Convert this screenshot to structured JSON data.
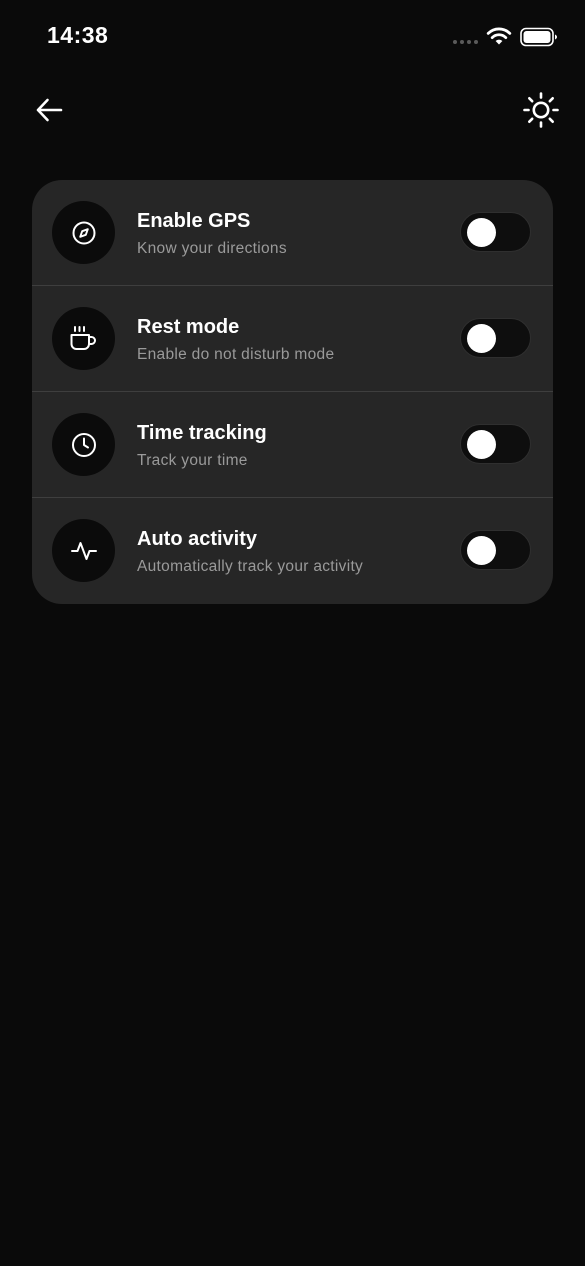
{
  "status_bar": {
    "time": "14:38"
  },
  "header": {
    "back_icon": "arrow-left-icon",
    "theme_icon": "sun-icon"
  },
  "settings": [
    {
      "icon": "compass-icon",
      "title": "Enable GPS",
      "subtitle": "Know your directions",
      "enabled": false
    },
    {
      "icon": "coffee-cup-icon",
      "title": "Rest mode",
      "subtitle": "Enable do not disturb mode",
      "enabled": false
    },
    {
      "icon": "clock-icon",
      "title": "Time tracking",
      "subtitle": "Track your time",
      "enabled": false
    },
    {
      "icon": "activity-pulse-icon",
      "title": "Auto activity",
      "subtitle": "Automatically track your activity",
      "enabled": false
    }
  ],
  "colors": {
    "background": "#0a0a0a",
    "card": "#262626",
    "icon_circle": "#0b0b0b",
    "subtitle": "#9a9a9a",
    "toggle_track": "#0e0e0e",
    "toggle_knob": "#ffffff"
  }
}
